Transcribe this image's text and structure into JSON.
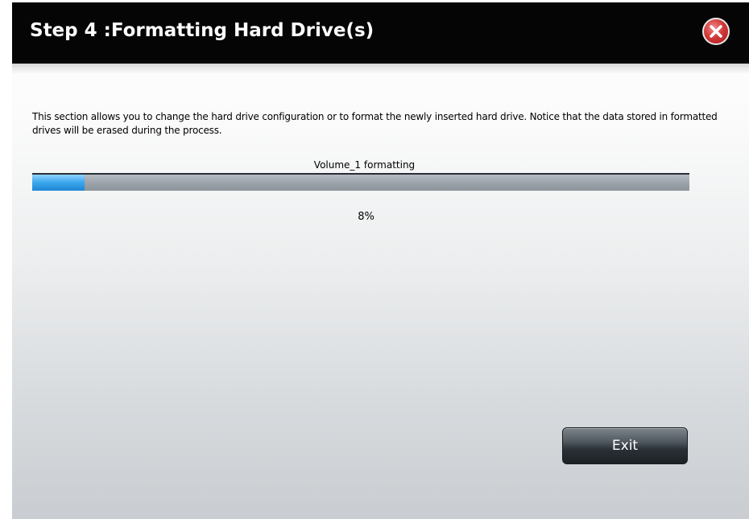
{
  "dialog": {
    "title": "Step 4 :Formatting Hard Drive(s)",
    "close_icon": "close-icon",
    "description": "This section allows you to change the hard drive configuration or to format the newly inserted hard drive. Notice that the data stored in formatted drives will be erased during the process.",
    "progress": {
      "label": "Volume_1 formatting",
      "value": 0.08,
      "percent_text": "8%"
    },
    "exit_label": "Exit"
  },
  "colors": {
    "titlebar": "#050505",
    "progress_fill": "#3aa6ec",
    "progress_track": "#9aa1a8",
    "close_button": "#d23a3a"
  }
}
